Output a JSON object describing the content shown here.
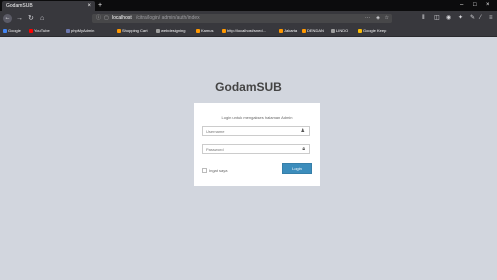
{
  "browser": {
    "tab_title": "GodamSUB",
    "tab_close": "×",
    "new_tab": "+",
    "window_controls": [
      "–",
      "□",
      "×"
    ],
    "url_host": "localhost",
    "url_path": "/citra/login/ admin/auth/index",
    "url_menu": "···",
    "bookmarks": [
      {
        "label": "Google",
        "color": "#4285f4"
      },
      {
        "label": "YouTube",
        "color": "#ff0000"
      },
      {
        "label": "phpMyAdmin",
        "color": "#6c78af"
      },
      {
        "label": "Shopping Cart",
        "color": "#ff9800"
      },
      {
        "label": "webdesigning",
        "color": "#9e9e9e"
      },
      {
        "label": "Kamus",
        "color": "#ff9800"
      },
      {
        "label": "http://localhost/sned...",
        "color": "#ff9800"
      },
      {
        "label": "Jakarta",
        "color": "#ff9800"
      },
      {
        "label": "DENDAN",
        "color": "#ff9800"
      },
      {
        "label": "LINDO",
        "color": "#9e9e9e"
      },
      {
        "label": "Google Keep",
        "color": "#fbbc04"
      }
    ]
  },
  "page": {
    "brand": "GodamSUB",
    "login_message": "Login untuk mengakses halaman Admin",
    "username_placeholder": "Username",
    "password_placeholder": "Password",
    "remember_label": "Ingat saya",
    "signin_label": "Login"
  }
}
